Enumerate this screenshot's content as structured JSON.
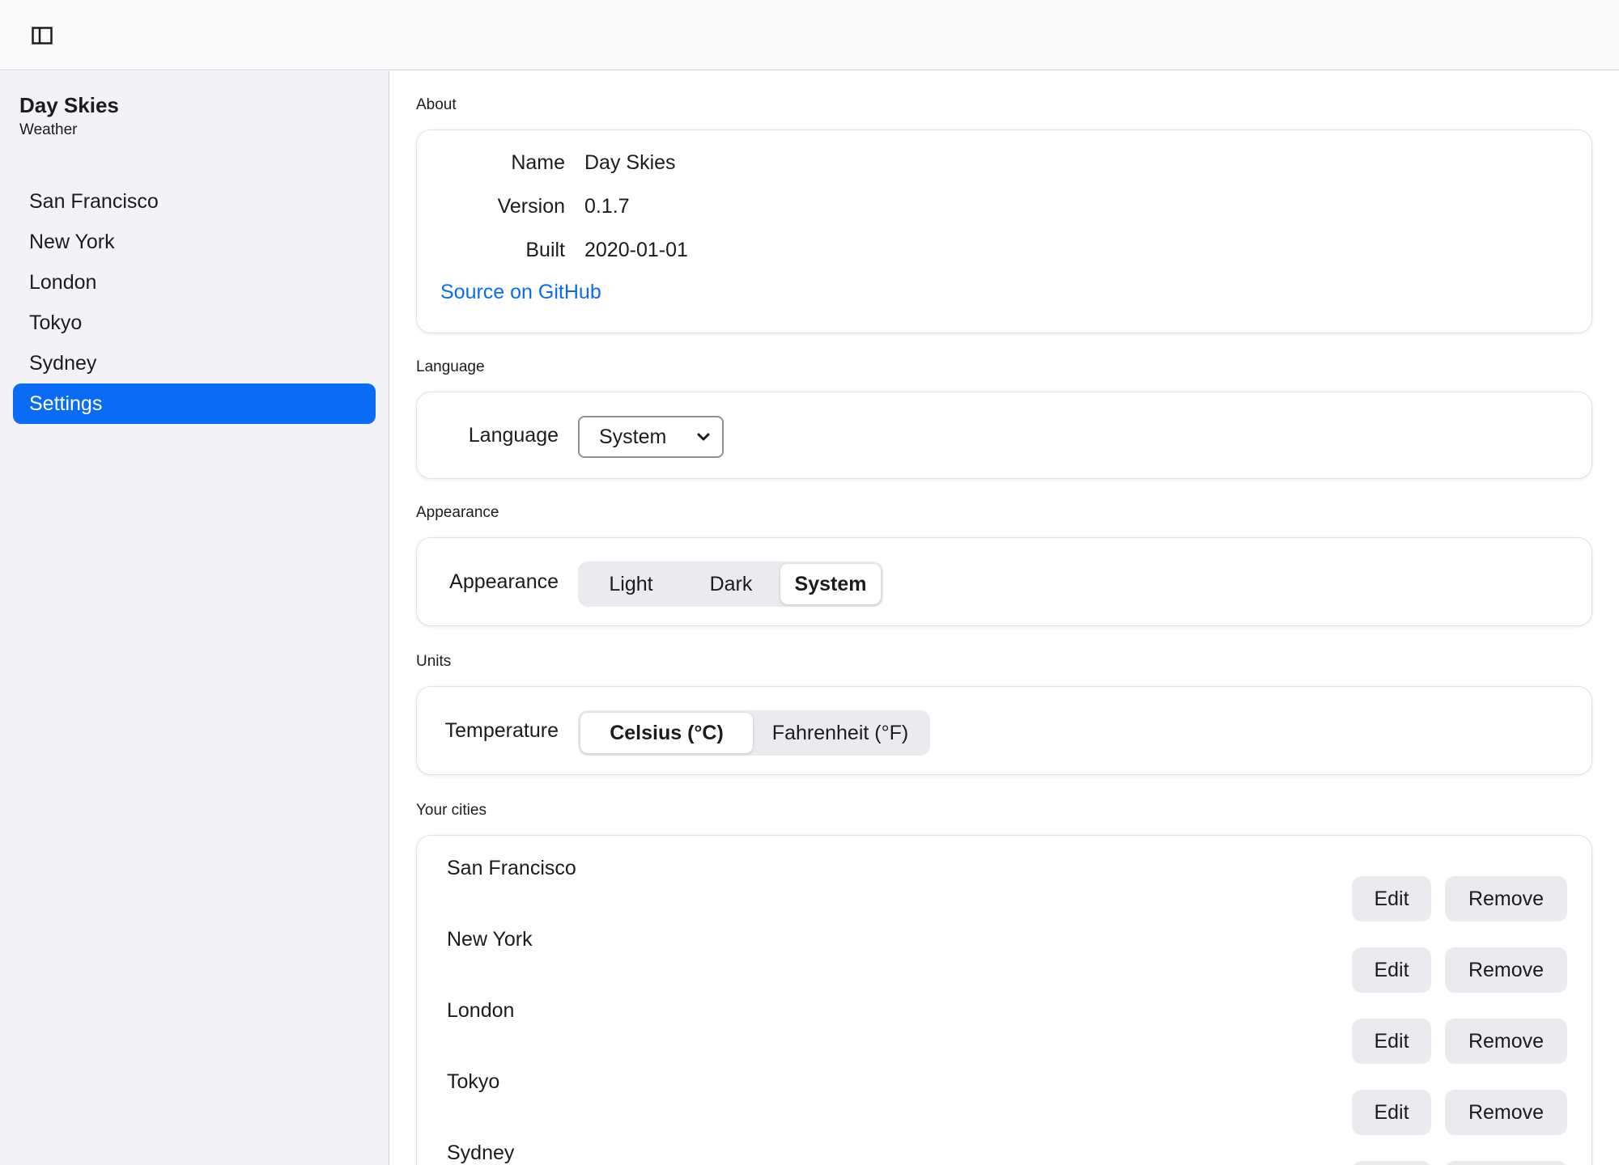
{
  "sidebar": {
    "app_name": "Day Skies",
    "app_subtitle": "Weather",
    "items": [
      {
        "label": "San Francisco"
      },
      {
        "label": "New York"
      },
      {
        "label": "London"
      },
      {
        "label": "Tokyo"
      },
      {
        "label": "Sydney"
      },
      {
        "label": "Settings"
      }
    ],
    "active_item": "Settings"
  },
  "about": {
    "section_label": "About",
    "rows": [
      {
        "key": "Name",
        "value": "Day Skies"
      },
      {
        "key": "Version",
        "value": "0.1.7"
      },
      {
        "key": "Built",
        "value": "2020-01-01"
      }
    ],
    "link": "Source on GitHub"
  },
  "language": {
    "section_label": "Language",
    "field_label": "Language",
    "selected": "System"
  },
  "appearance": {
    "section_label": "Appearance",
    "field_label": "Appearance",
    "options": [
      "Light",
      "Dark",
      "System"
    ],
    "selected": "System"
  },
  "units": {
    "section_label": "Units",
    "field_label": "Temperature",
    "options": [
      "Celsius (°C)",
      "Fahrenheit (°F)"
    ],
    "selected": "Celsius (°C)"
  },
  "cities": {
    "section_label": "Your cities",
    "edit_label": "Edit",
    "remove_label": "Remove",
    "items": [
      {
        "name": "San Francisco"
      },
      {
        "name": "New York"
      },
      {
        "name": "London"
      },
      {
        "name": "Tokyo"
      },
      {
        "name": "Sydney"
      }
    ]
  },
  "colors": {
    "accent": "#0a6cf5",
    "sidebar_bg": "#f2f2f7",
    "segment_bg": "#ebebef"
  },
  "icons": {
    "sidebar_toggle": "sidebar-toggle-icon",
    "select_chevron": "chevron-down-icon"
  }
}
